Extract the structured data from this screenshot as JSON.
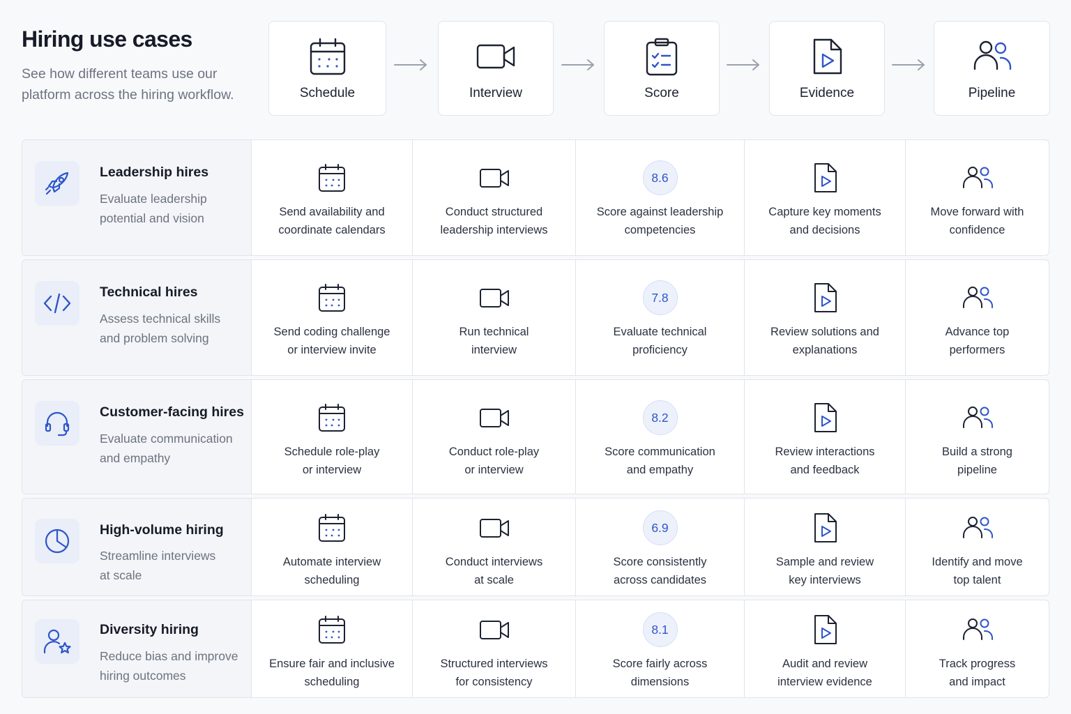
{
  "header": {
    "title": "Hiring use cases",
    "subtitle_line1": "See how different teams use our",
    "subtitle_line2": "platform across the hiring workflow."
  },
  "stages": [
    {
      "label": "Schedule",
      "icon": "calendar-icon"
    },
    {
      "label": "Interview",
      "icon": "video-camera-icon"
    },
    {
      "label": "Score",
      "icon": "clipboard-checklist-icon"
    },
    {
      "label": "Evidence",
      "icon": "play-document-icon"
    },
    {
      "label": "Pipeline",
      "icon": "users-icon"
    }
  ],
  "accent_color": "#2e55c9",
  "rows": [
    {
      "name": "Leadership hires",
      "icon": "rocket-icon",
      "desc1": "Evaluate leadership",
      "desc2": "potential and vision",
      "schedule1": "Send availability and",
      "schedule2": "coordinate calendars",
      "interview1": "Conduct structured",
      "interview2": "leadership interviews",
      "score": "8.6",
      "score1": "Score against leadership",
      "score2": "competencies",
      "evidence1": "Capture key moments",
      "evidence2": "and decisions",
      "pipeline1": "Move forward with",
      "pipeline2": "confidence"
    },
    {
      "name": "Technical hires",
      "icon": "code-icon",
      "desc1": "Assess technical skills",
      "desc2": "and problem solving",
      "schedule1": "Send coding challenge",
      "schedule2": "or interview invite",
      "interview1": "Run technical",
      "interview2": "interview",
      "score": "7.8",
      "score1": "Evaluate technical",
      "score2": "proficiency",
      "evidence1": "Review solutions and",
      "evidence2": "explanations",
      "pipeline1": "Advance top",
      "pipeline2": "performers"
    },
    {
      "name": "Customer-facing hires",
      "icon": "headset-icon",
      "desc1": "Evaluate communication",
      "desc2": "and empathy",
      "schedule1": "Schedule role-play",
      "schedule2": "or interview",
      "interview1": "Conduct role-play",
      "interview2": "or interview",
      "score": "8.2",
      "score1": "Score communication",
      "score2": "and empathy",
      "evidence1": "Review interactions",
      "evidence2": "and feedback",
      "pipeline1": "Build a strong",
      "pipeline2": "pipeline"
    },
    {
      "name": "High-volume hiring",
      "icon": "pie-chart-icon",
      "desc1": "Streamline interviews",
      "desc2": "at scale",
      "schedule1": "Automate interview",
      "schedule2": "scheduling",
      "interview1": "Conduct interviews",
      "interview2": "at scale",
      "score": "6.9",
      "score1": "Score consistently",
      "score2": "across candidates",
      "evidence1": "Sample and review",
      "evidence2": "key interviews",
      "pipeline1": "Identify and move",
      "pipeline2": "top talent"
    },
    {
      "name": "Diversity hiring",
      "icon": "user-star-icon",
      "desc1": "Reduce bias and improve",
      "desc2": "hiring outcomes",
      "schedule1": "Ensure fair and inclusive",
      "schedule2": "scheduling",
      "interview1": "Structured interviews",
      "interview2": "for consistency",
      "score": "8.1",
      "score1": "Score fairly across",
      "score2": "dimensions",
      "evidence1": "Audit and review",
      "evidence2": "interview evidence",
      "pipeline1": "Track progress",
      "pipeline2": "and impact"
    }
  ]
}
